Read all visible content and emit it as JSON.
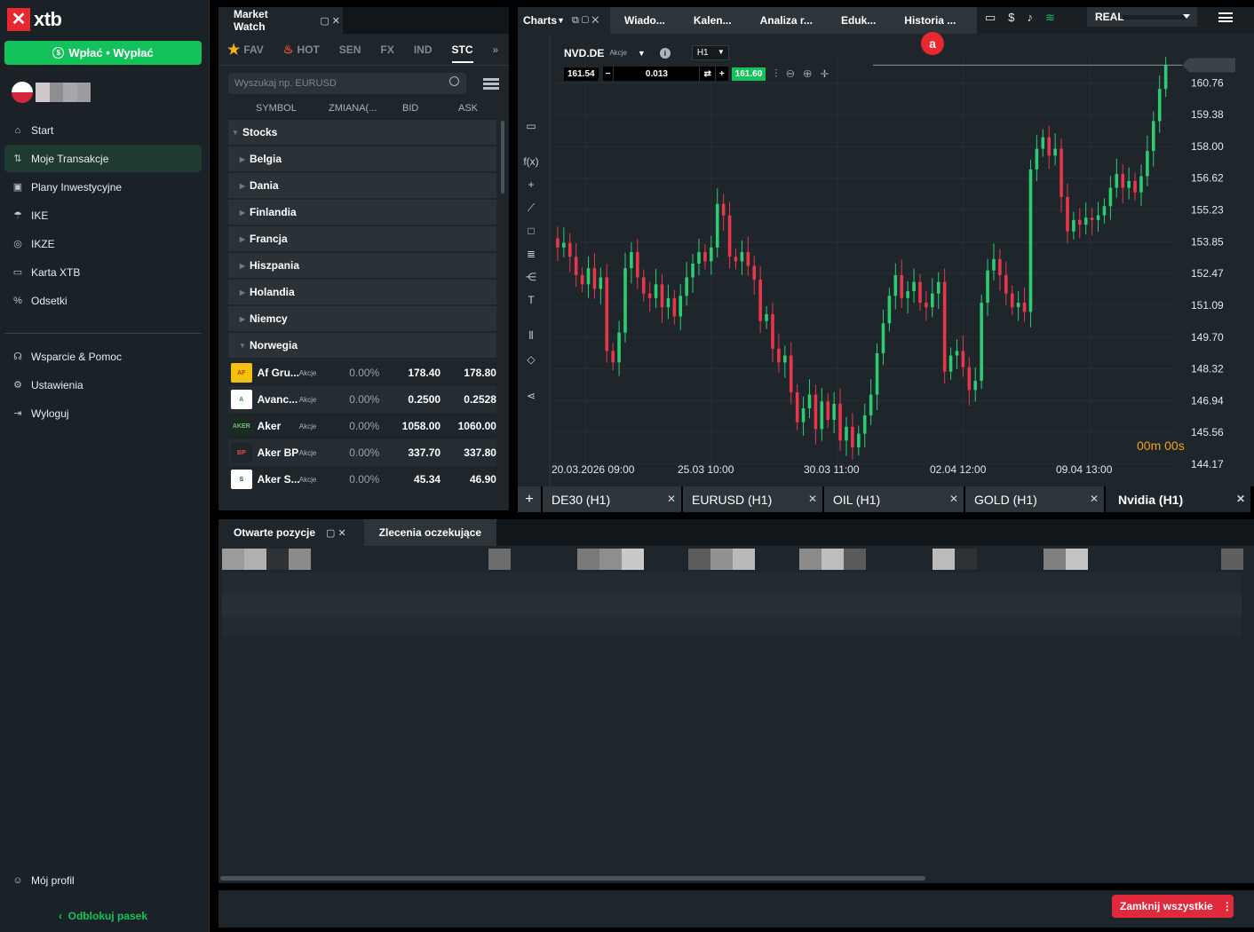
{
  "sidebar": {
    "logo_text": "xtb",
    "deposit_label": "Wpłać • Wypłać",
    "nav": [
      {
        "label": "Start",
        "icon": "home-icon"
      },
      {
        "label": "Moje Transakcje",
        "icon": "transactions-icon"
      },
      {
        "label": "Plany Inwestycyjne",
        "icon": "plans-icon"
      },
      {
        "label": "IKE",
        "icon": "ike-icon"
      },
      {
        "label": "IKZE",
        "icon": "ikze-icon"
      },
      {
        "label": "Karta XTB",
        "icon": "card-icon"
      },
      {
        "label": "Odsetki",
        "icon": "percent-icon"
      }
    ],
    "support": [
      {
        "label": "Wsparcie & Pomoc",
        "icon": "headset-icon"
      },
      {
        "label": "Ustawienia",
        "icon": "gear-icon"
      },
      {
        "label": "Wyloguj",
        "icon": "logout-icon"
      }
    ],
    "profile_label": "Mój profil",
    "unlock_label": "Odblokuj pasek",
    "active_item": "Moje Transakcje"
  },
  "market_watch": {
    "title": "Market Watch",
    "tabs": [
      "FAV",
      "HOT",
      "SEN",
      "FX",
      "IND",
      "STC"
    ],
    "active_tab": "STC",
    "search_placeholder": "Wyszukaj np. EURUSD",
    "columns": [
      "SYMBOL",
      "ZMIANA(...",
      "BID",
      "ASK"
    ],
    "groups": [
      "Stocks",
      "Belgia",
      "Dania",
      "Finlandia",
      "Francja",
      "Hiszpania",
      "Holandia",
      "Niemcy",
      "Norwegia"
    ],
    "rows": [
      {
        "name": "Af Gru...",
        "type": "Akcje",
        "change": "0.00%",
        "bid": "178.40",
        "ask": "178.80",
        "logo": "AF",
        "logo_bg": "#f4c20d",
        "logo_fg": "#c0392b"
      },
      {
        "name": "Avanc...",
        "type": "Akcje",
        "change": "0.00%",
        "bid": "0.2500",
        "ask": "0.2528",
        "logo": "A",
        "logo_bg": "#ffffff",
        "logo_fg": "#2f8a5a"
      },
      {
        "name": "Aker",
        "type": "Akcje",
        "change": "0.00%",
        "bid": "1058.00",
        "ask": "1060.00",
        "logo": "AKER",
        "logo_bg": "#1d2a24",
        "logo_fg": "#6fbf7a"
      },
      {
        "name": "Aker BP",
        "type": "Akcje",
        "change": "0.00%",
        "bid": "337.70",
        "ask": "337.80",
        "logo": "BP",
        "logo_bg": "#1e262b",
        "logo_fg": "#e74c3c"
      },
      {
        "name": "Aker S...",
        "type": "Akcje",
        "change": "0.00%",
        "bid": "45.34",
        "ask": "46.90",
        "logo": "S",
        "logo_bg": "#ffffff",
        "logo_fg": "#1b4d3e"
      }
    ]
  },
  "charts": {
    "title": "Charts",
    "tabs": [
      "Wiado...",
      "Kalen...",
      "Analiza r...",
      "Eduk...",
      "Historia ..."
    ],
    "account_mode": "REAL",
    "badge": "a",
    "symbol": "NVD.DE",
    "symbol_type": "Akcje",
    "timeframe": "H1",
    "sell_price": "161.54",
    "volume": "0.013",
    "buy_price": "161.60",
    "current_price_label": "161.54",
    "timer": "00m 00s",
    "instrument_tabs": [
      {
        "label": "DE30 (H1)",
        "active": false
      },
      {
        "label": "EURUSD (H1)",
        "active": false
      },
      {
        "label": "OIL (H1)",
        "active": false
      },
      {
        "label": "GOLD (H1)",
        "active": false
      },
      {
        "label": "Nvidia (H1)",
        "active": true
      }
    ],
    "colors": {
      "up": "#2ecc71",
      "down": "#e8364a",
      "bg": "#1e262b",
      "grid": "#262f34"
    }
  },
  "chart_data": {
    "type": "candlestick",
    "x_ticks": [
      "20.03.2026 09:00",
      "25.03 10:00",
      "30.03 11:00",
      "02.04 12:00",
      "09.04 13:00"
    ],
    "y_ticks": [
      161.54,
      160.76,
      159.38,
      158.0,
      156.62,
      155.23,
      153.85,
      152.47,
      151.09,
      149.7,
      148.32,
      146.94,
      145.56,
      144.17
    ],
    "ylim": [
      144.17,
      161.9
    ],
    "grid": true,
    "close_series": [
      154.0,
      153.6,
      153.8,
      153.2,
      152.4,
      152.0,
      152.7,
      151.8,
      152.3,
      149.1,
      148.6,
      149.9,
      152.7,
      153.4,
      152.3,
      151.6,
      151.4,
      152.0,
      151.0,
      151.4,
      150.6,
      151.5,
      152.3,
      152.9,
      153.4,
      153.0,
      153.6,
      155.5,
      155.0,
      153.2,
      153.0,
      153.4,
      152.8,
      152.2,
      150.4,
      150.7,
      149.2,
      148.6,
      148.9,
      147.3,
      146.0,
      146.6,
      147.2,
      145.7,
      146.9,
      146.1,
      146.8,
      145.2,
      145.8,
      144.9,
      145.5,
      146.3,
      147.2,
      149.0,
      150.3,
      151.5,
      152.4,
      151.4,
      151.7,
      152.1,
      151.2,
      151.0,
      151.6,
      152.1,
      148.2,
      148.9,
      149.1,
      148.4,
      147.4,
      147.8,
      151.2,
      152.6,
      153.1,
      152.4,
      151.6,
      151.0,
      151.2,
      150.8,
      157.0,
      157.9,
      158.4,
      157.6,
      157.9,
      155.8,
      154.3,
      154.8,
      154.6,
      154.9,
      154.8,
      155.0,
      155.4,
      156.2,
      156.8,
      156.2,
      156.5,
      156.0,
      156.7,
      157.8,
      159.1,
      160.5,
      161.54
    ]
  },
  "positions": {
    "tabs": [
      "Otwarte pozycje",
      "Zlecenia oczekujące"
    ],
    "active_tab": "Otwarte pozycje"
  },
  "footer": {
    "close_all_label": "Zamknij wszystkie"
  }
}
